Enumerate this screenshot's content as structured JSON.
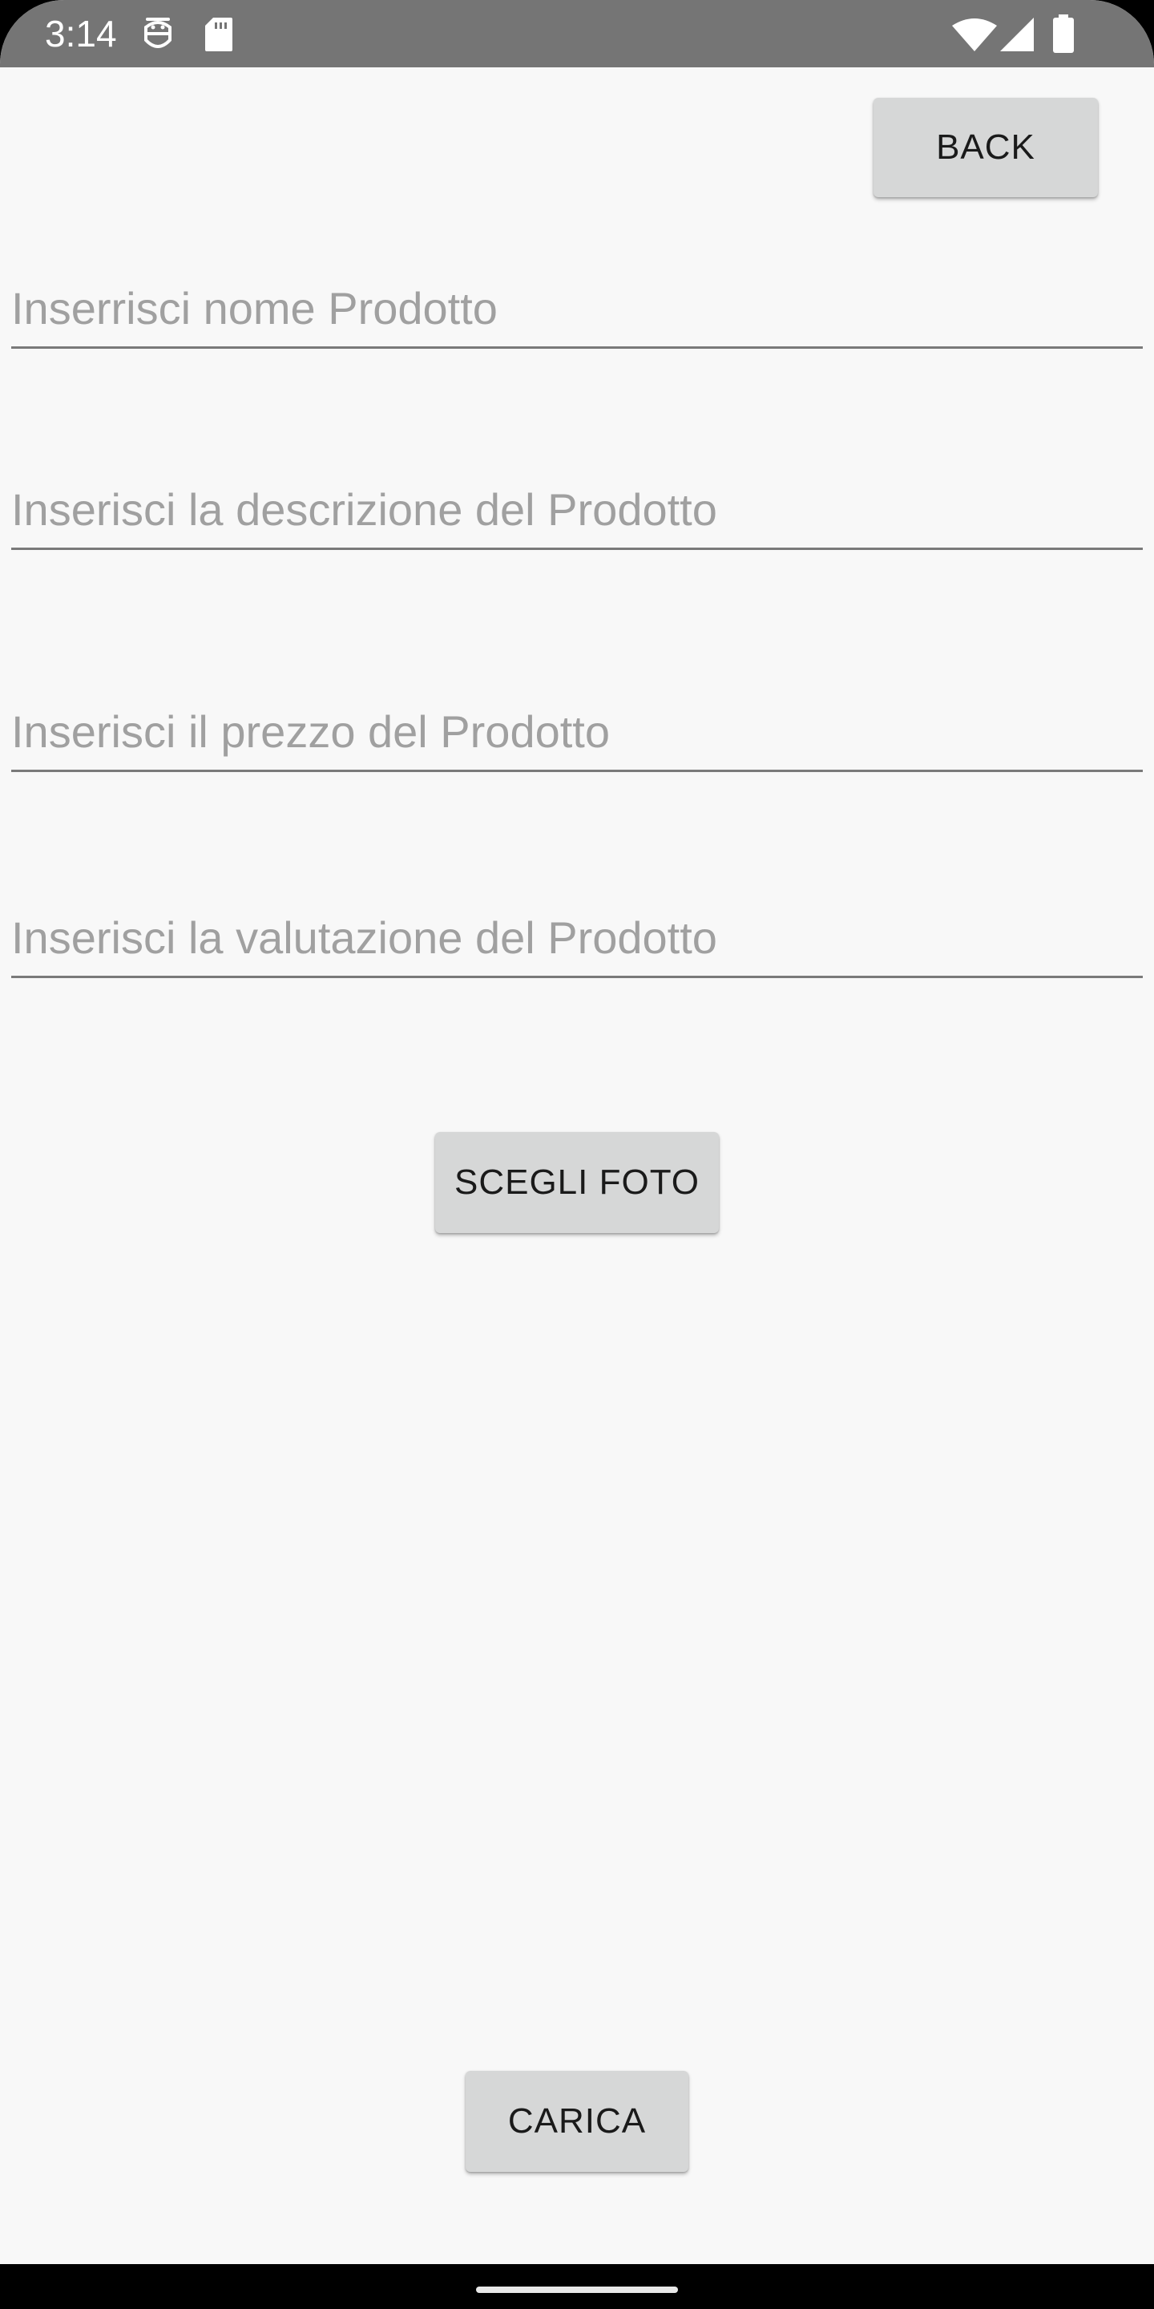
{
  "status_bar": {
    "time": "3:14",
    "left_icons": [
      "robot-face-icon",
      "sd-card-icon"
    ],
    "right_icons": [
      "wifi-icon",
      "cellular-signal-icon",
      "battery-icon"
    ],
    "background": "#757575"
  },
  "header": {
    "back_label": "BACK"
  },
  "form": {
    "product_name": {
      "placeholder": "Inserrisci nome Prodotto",
      "value": ""
    },
    "product_description": {
      "placeholder": "Inserisci la descrizione del Prodotto",
      "value": ""
    },
    "product_price": {
      "placeholder": "Inserisci il prezzo del Prodotto",
      "value": ""
    },
    "product_rating": {
      "placeholder": "Inserisci la valutazione del Prodotto",
      "value": ""
    }
  },
  "actions": {
    "choose_photo_label": "SCEGLI FOTO",
    "upload_label": "CARICA"
  },
  "colors": {
    "screen_background": "#f8f8f8",
    "button_background": "#d6d7d7",
    "placeholder_text": "#a0a0a0",
    "underline": "#7a7a7a"
  }
}
